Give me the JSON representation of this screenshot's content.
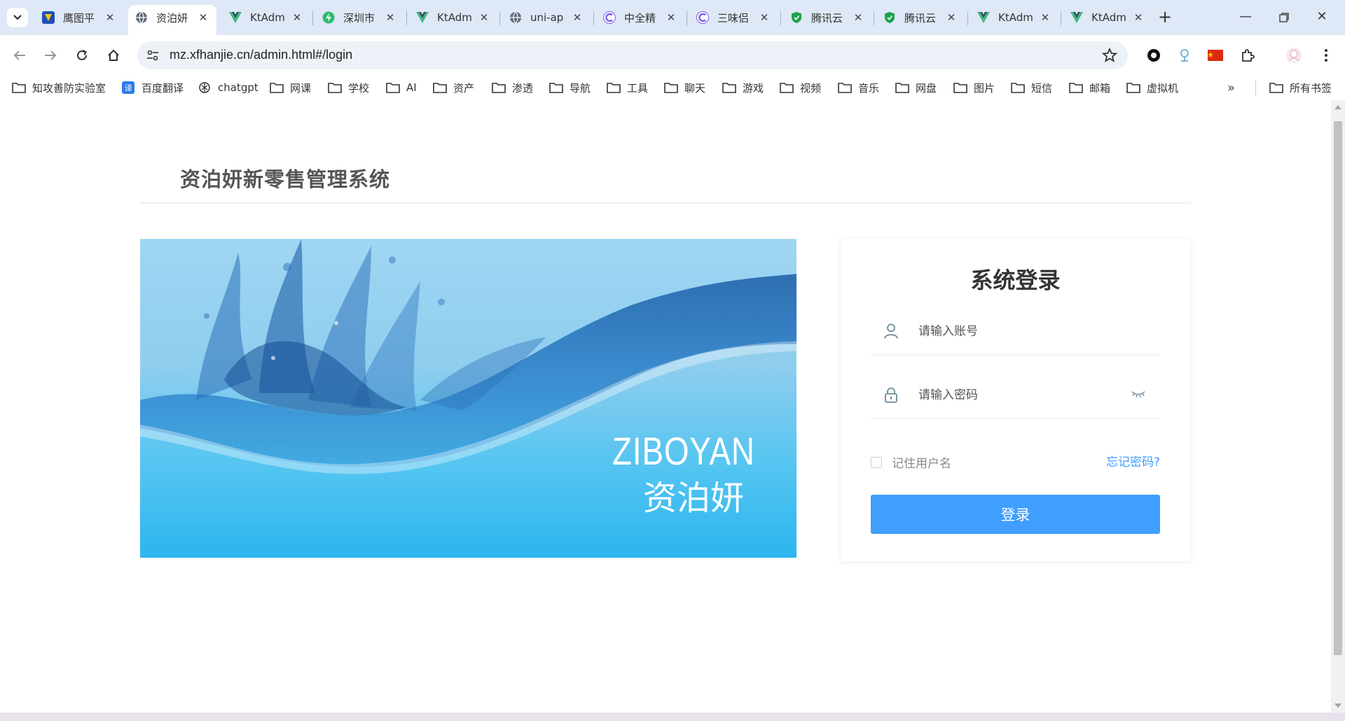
{
  "browser": {
    "tabs": [
      {
        "label": "鹰图平",
        "icon": "hunter-icon",
        "active": false
      },
      {
        "label": "资泊妍",
        "icon": "globe-icon",
        "active": true
      },
      {
        "label": "KtAdm",
        "icon": "vue-icon",
        "active": false
      },
      {
        "label": "深圳市",
        "icon": "bolt-icon",
        "active": false
      },
      {
        "label": "KtAdm",
        "icon": "vue-icon",
        "active": false
      },
      {
        "label": "uni-ap",
        "icon": "globe-icon",
        "active": false
      },
      {
        "label": "中全精",
        "icon": "c-icon",
        "active": false
      },
      {
        "label": "三味侣",
        "icon": "c-icon",
        "active": false
      },
      {
        "label": "腾讯云",
        "icon": "shield-icon",
        "active": false
      },
      {
        "label": "腾讯云",
        "icon": "shield-icon",
        "active": false
      },
      {
        "label": "KtAdm",
        "icon": "vue-icon",
        "active": false
      },
      {
        "label": "KtAdm",
        "icon": "vue-icon",
        "active": false
      }
    ],
    "url": "mz.xfhanjie.cn/admin.html#/login",
    "bookmarks": [
      {
        "label": "知攻善防实验室",
        "icon": "folder-icon"
      },
      {
        "label": "百度翻译",
        "icon": "translate-icon"
      },
      {
        "label": "chatgpt",
        "icon": "chatgpt-icon"
      },
      {
        "label": "网课",
        "icon": "folder-icon"
      },
      {
        "label": "学校",
        "icon": "folder-icon"
      },
      {
        "label": "AI",
        "icon": "folder-icon"
      },
      {
        "label": "资产",
        "icon": "folder-icon"
      },
      {
        "label": "渗透",
        "icon": "folder-icon"
      },
      {
        "label": "导航",
        "icon": "folder-icon"
      },
      {
        "label": "工具",
        "icon": "folder-icon"
      },
      {
        "label": "聊天",
        "icon": "folder-icon"
      },
      {
        "label": "游戏",
        "icon": "folder-icon"
      },
      {
        "label": "视频",
        "icon": "folder-icon"
      },
      {
        "label": "音乐",
        "icon": "folder-icon"
      },
      {
        "label": "网盘",
        "icon": "folder-icon"
      },
      {
        "label": "图片",
        "icon": "folder-icon"
      },
      {
        "label": "短信",
        "icon": "folder-icon"
      },
      {
        "label": "邮箱",
        "icon": "folder-icon"
      },
      {
        "label": "虚拟机",
        "icon": "folder-icon"
      }
    ],
    "all_bookmarks": "所有书签",
    "colors": {
      "tabstrip": "#dfe8f6",
      "omnibox": "#edf1f8"
    }
  },
  "page": {
    "system_title": "资泊妍新零售管理系统",
    "banner": {
      "brand_en": "ZIBOYAN",
      "brand_cn": "资泊妍"
    },
    "login": {
      "title": "系统登录",
      "username_placeholder": "请输入账号",
      "password_placeholder": "请输入密码",
      "remember_label": "记住用户名",
      "forgot_label": "忘记密码?",
      "submit_label": "登录"
    },
    "colors": {
      "primary": "#409eff",
      "title": "#555555"
    }
  }
}
